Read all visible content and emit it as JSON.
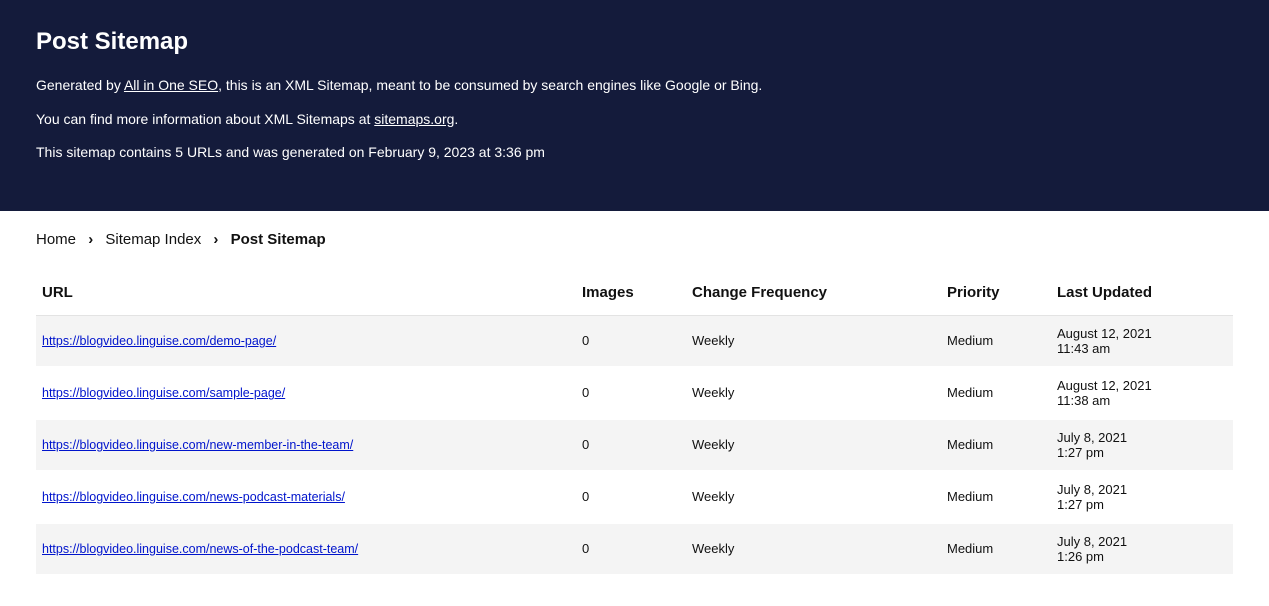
{
  "header": {
    "title": "Post Sitemap",
    "line1_pre": "Generated by ",
    "line1_link": "All in One SEO",
    "line1_post": ", this is an XML Sitemap, meant to be consumed by search engines like Google or Bing.",
    "line2_pre": "You can find more information about XML Sitemaps at ",
    "line2_link": "sitemaps.org",
    "line2_post": ".",
    "line3": "This sitemap contains 5 URLs and was generated on February 9, 2023 at 3:36 pm"
  },
  "breadcrumb": {
    "home": "Home",
    "index": "Sitemap Index",
    "current": "Post Sitemap",
    "sep": "›"
  },
  "table": {
    "headers": {
      "url": "URL",
      "images": "Images",
      "freq": "Change Frequency",
      "priority": "Priority",
      "updated": "Last Updated"
    },
    "rows": [
      {
        "url": "https://blogvideo.linguise.com/demo-page/",
        "images": "0",
        "freq": "Weekly",
        "priority": "Medium",
        "updated_date": "August 12, 2021",
        "updated_time": "11:43 am"
      },
      {
        "url": "https://blogvideo.linguise.com/sample-page/",
        "images": "0",
        "freq": "Weekly",
        "priority": "Medium",
        "updated_date": "August 12, 2021",
        "updated_time": "11:38 am"
      },
      {
        "url": "https://blogvideo.linguise.com/new-member-in-the-team/",
        "images": "0",
        "freq": "Weekly",
        "priority": "Medium",
        "updated_date": "July 8, 2021",
        "updated_time": "1:27 pm"
      },
      {
        "url": "https://blogvideo.linguise.com/news-podcast-materials/",
        "images": "0",
        "freq": "Weekly",
        "priority": "Medium",
        "updated_date": "July 8, 2021",
        "updated_time": "1:27 pm"
      },
      {
        "url": "https://blogvideo.linguise.com/news-of-the-podcast-team/",
        "images": "0",
        "freq": "Weekly",
        "priority": "Medium",
        "updated_date": "July 8, 2021",
        "updated_time": "1:26 pm"
      }
    ]
  }
}
